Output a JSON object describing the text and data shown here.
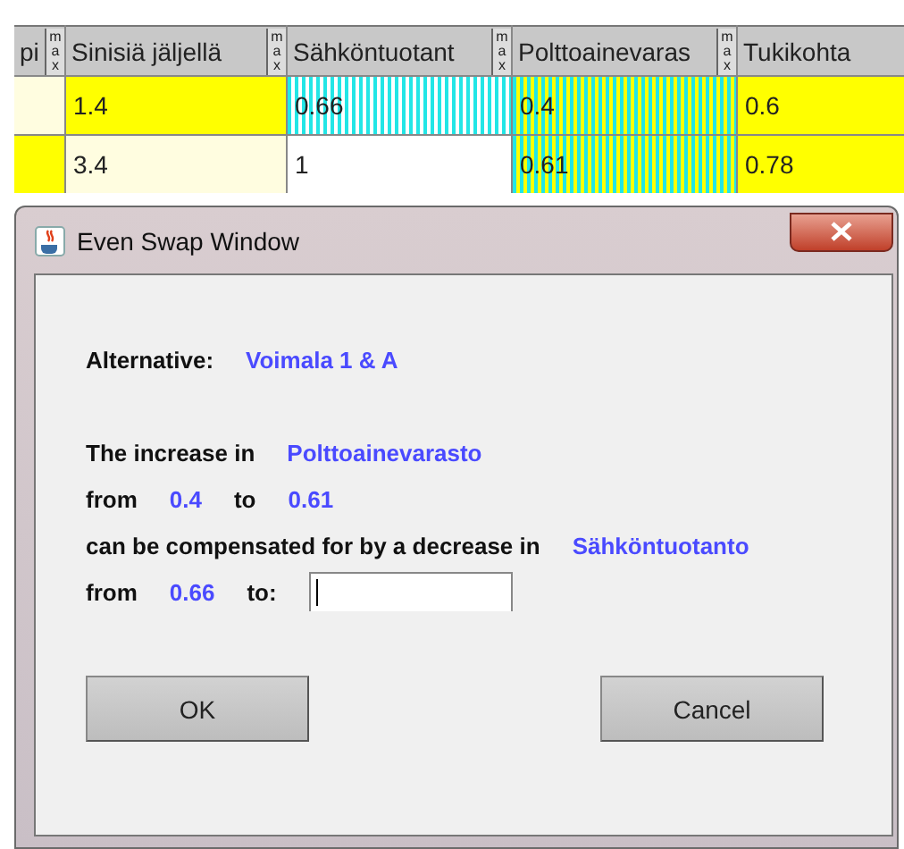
{
  "table": {
    "columns": [
      {
        "label": "pi",
        "marker": "max"
      },
      {
        "label": "Sinisiä jäljellä",
        "marker": "max"
      },
      {
        "label": "Sähköntuotant",
        "marker": "max"
      },
      {
        "label": "Polttoainevaras",
        "marker": "max"
      },
      {
        "label": "Tukikohta"
      }
    ],
    "rows": [
      {
        "cells": [
          {
            "color": "#fffde0",
            "striped": false
          },
          {
            "text": "1.4",
            "color": "#ffff00",
            "striped": false
          },
          {
            "text": "0.66",
            "color": "#ffffff",
            "striped": true
          },
          {
            "text": "0.4",
            "color": "#ffff00",
            "striped": true
          },
          {
            "text": "0.6",
            "color": "#ffff00",
            "striped": false
          }
        ]
      },
      {
        "cells": [
          {
            "color": "#ffff00",
            "striped": false
          },
          {
            "text": "3.4",
            "color": "#fffde0",
            "striped": false
          },
          {
            "text": "1",
            "color": "#ffffff",
            "striped": false
          },
          {
            "text": "0.61",
            "color": "#ffff00",
            "striped": true
          },
          {
            "text": "0.78",
            "color": "#ffff00",
            "striped": false
          }
        ]
      }
    ]
  },
  "dialog": {
    "title": "Even Swap Window",
    "alternative": {
      "label": "Alternative:",
      "value": "Voimala 1 & A"
    },
    "lines": [
      {
        "parts": [
          {
            "kind": "label",
            "text": "The increase in"
          },
          {
            "kind": "value",
            "text": "Polttoainevarasto"
          }
        ]
      },
      {
        "parts": [
          {
            "kind": "label",
            "text": "from"
          },
          {
            "kind": "value",
            "text": "0.4"
          },
          {
            "kind": "label",
            "text": "to"
          },
          {
            "kind": "value",
            "text": "0.61"
          }
        ]
      },
      {
        "parts": [
          {
            "kind": "label",
            "text": "can be compensated for by a decrease in"
          },
          {
            "kind": "value",
            "text": "Sähköntuotanto"
          }
        ]
      },
      {
        "parts": [
          {
            "kind": "label",
            "text": "from"
          },
          {
            "kind": "value",
            "text": "0.66"
          },
          {
            "kind": "label",
            "text": "to:"
          },
          {
            "kind": "field",
            "focused": true
          }
        ]
      }
    ],
    "buttons": [
      "OK",
      "Cancel"
    ]
  }
}
